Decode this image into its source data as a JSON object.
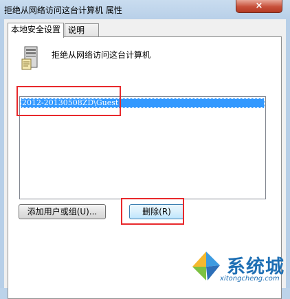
{
  "window": {
    "title": "拒绝从网络访问这台计算机 属性",
    "close_label": "×"
  },
  "tabs": [
    {
      "label": "本地安全设置",
      "active": true
    },
    {
      "label": "说明",
      "active": false
    }
  ],
  "policy": {
    "icon": "server-icon",
    "name": "拒绝从网络访问这台计算机"
  },
  "accounts": {
    "items": [
      "2012-20130508ZD\\Guest"
    ],
    "selected": "2012-20130508ZD\\Guest"
  },
  "buttons": {
    "add_label": "添加用户或组(U)...",
    "remove_label": "删除(R)"
  },
  "watermark": {
    "name": "系统城",
    "url": "xitongcheng.com"
  },
  "colors": {
    "selection": "#3399ff",
    "highlight": "#e8292c",
    "watermark": "#1e6fb4"
  }
}
